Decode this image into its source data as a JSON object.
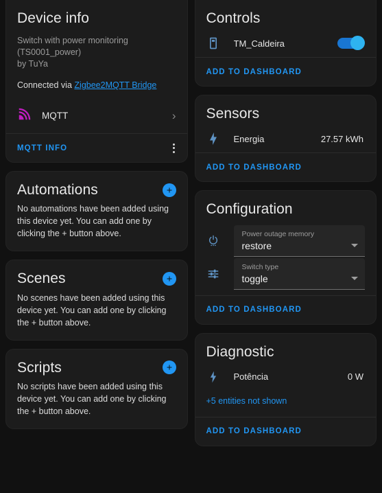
{
  "theme": {
    "background": "#111111",
    "card_background": "#1c1c1c",
    "accent": "#2196f3",
    "mqtt_icon_color": "#c21dc2",
    "entity_icon_color": "#5f93c4",
    "text_primary": "#e6e6e6",
    "text_secondary": "#9b9b9b"
  },
  "left_column": {
    "device_info": {
      "title": "Device info",
      "model_line1": "Switch with power monitoring",
      "model_line2": "(TS0001_power)",
      "manufacturer_line": "by TuYa",
      "connected_prefix": "Connected via",
      "connected_link": "Zigbee2MQTT Bridge",
      "integration": {
        "name": "MQTT",
        "icon": "mqtt-signal-icon",
        "chevron": "›"
      },
      "actions": {
        "info_label": "MQTT INFO",
        "overflow_icon": "dots-vertical-icon"
      }
    },
    "automations": {
      "title": "Automations",
      "add_icon": "plus-icon",
      "empty_text": "No automations have been added using this device yet. You can add one by clicking the + button above."
    },
    "scenes": {
      "title": "Scenes",
      "add_icon": "plus-icon",
      "empty_text": "No scenes have been added using this device yet. You can add one by clicking the + button above."
    },
    "scripts": {
      "title": "Scripts",
      "add_icon": "plus-icon",
      "empty_text": "No scripts have been added using this device yet. You can add one by clicking the + button above."
    }
  },
  "right_column": {
    "controls": {
      "title": "Controls",
      "entities": [
        {
          "icon": "light-switch-icon",
          "name": "TM_Caldeira",
          "toggle_state": "on"
        }
      ],
      "add_to_dashboard_label": "ADD TO DASHBOARD"
    },
    "sensors": {
      "title": "Sensors",
      "entities": [
        {
          "icon": "lightning-bolt-icon",
          "name": "Energia",
          "value": "27.57 kWh"
        }
      ],
      "add_to_dashboard_label": "ADD TO DASHBOARD"
    },
    "configuration": {
      "title": "Configuration",
      "fields": [
        {
          "icon": "power-settings-icon",
          "label": "Power outage memory",
          "value": "restore"
        },
        {
          "icon": "tune-icon",
          "label": "Switch type",
          "value": "toggle"
        }
      ],
      "add_to_dashboard_label": "ADD TO DASHBOARD"
    },
    "diagnostic": {
      "title": "Diagnostic",
      "entities": [
        {
          "icon": "flash-icon",
          "name": "Potência",
          "value": "0 W"
        }
      ],
      "hidden_entities_label": "+5 entities not shown",
      "add_to_dashboard_label": "ADD TO DASHBOARD"
    }
  }
}
